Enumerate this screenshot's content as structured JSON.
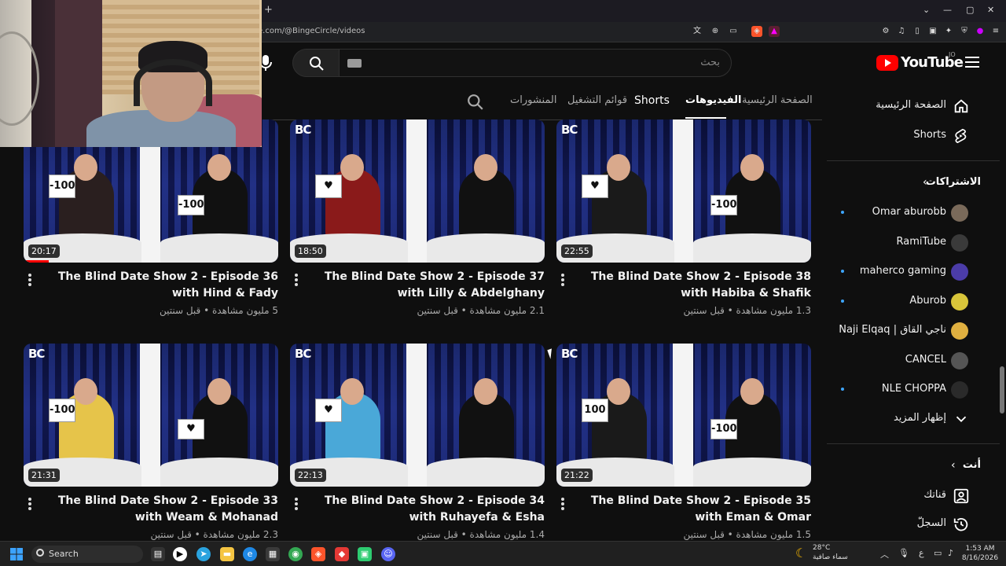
{
  "browser": {
    "url": "e.com/@BingeCircle/videos",
    "new_tab": "+"
  },
  "search": {
    "placeholder": "بحث"
  },
  "logo": {
    "name": "YouTube",
    "country": "JO"
  },
  "tabs": [
    {
      "label": "الصفحة الرئيسية"
    },
    {
      "label": "الفيديوهات"
    },
    {
      "label": "Shorts"
    },
    {
      "label": "قوائم التشغيل"
    },
    {
      "label": "المنشورات"
    }
  ],
  "videos": [
    {
      "title": "The Blind Date Show 2 - Episode 36 with Hind & Fady",
      "views": "5 مليون مشاهدة",
      "age": "قبل سنتين",
      "duration": "20:17",
      "progress": 0.1
    },
    {
      "title": "The Blind Date Show 2 - Episode 37 with Lilly & Abdelghany",
      "views": "2.1 مليون مشاهدة",
      "age": "قبل سنتين",
      "duration": "18:50",
      "progress": 0
    },
    {
      "title": "The Blind Date Show 2 - Episode 38 with Habiba & Shafik",
      "views": "1.3 مليون مشاهدة",
      "age": "قبل سنتين",
      "duration": "22:55",
      "progress": 0
    },
    {
      "title": "The Blind Date Show 2 - Episode 33 with Weam & Mohanad",
      "views": "2.3 مليون مشاهدة",
      "age": "قبل سنتين",
      "duration": "21:31",
      "progress": 0
    },
    {
      "title": "The Blind Date Show 2 - Episode 34 with Ruhayefa & Esha",
      "views": "1.4 مليون مشاهدة",
      "age": "قبل سنتين",
      "duration": "22:13",
      "progress": 0
    },
    {
      "title": "The Blind Date Show 2 - Episode 35 with Eman & Omar",
      "views": "1.5 مليون مشاهدة",
      "age": "قبل سنتين",
      "duration": "21:22",
      "progress": 0
    }
  ],
  "thumb_signs": [
    "-100",
    "♥",
    "♥",
    "-100",
    "♥",
    "100"
  ],
  "thumb_signs_right": [
    "-100",
    "",
    "-100",
    "♥",
    "",
    "-100"
  ],
  "sidebar": {
    "home": "الصفحة الرئيسية",
    "shorts": "Shorts",
    "subs_header": "الاشتراكات",
    "subs": [
      {
        "name": "Omar aburobb",
        "dot": true,
        "color": "#7a6a5a"
      },
      {
        "name": "RamiTube",
        "dot": false,
        "color": "#3a3a3a"
      },
      {
        "name": "maherco gaming",
        "dot": true,
        "color": "#4b3ca8"
      },
      {
        "name": "Aburob",
        "dot": true,
        "color": "#d8c53a"
      },
      {
        "name": "Naji Elqaq | ناجي القاق",
        "dot": false,
        "color": "#e0b040"
      },
      {
        "name": "CANCEL",
        "dot": false,
        "color": "#555555"
      },
      {
        "name": "NLE CHOPPA",
        "dot": true,
        "color": "#2a2a2a"
      }
    ],
    "show_more": "إظهار المزيد",
    "you_header": "أنت",
    "channel": "قناتك",
    "history": "السجلّ"
  },
  "taskbar": {
    "search": "Search",
    "temp": "28°C",
    "cond": "سماء صافية",
    "time": "1:53 AM",
    "date": "8/16/2026",
    "lang": "ع"
  }
}
